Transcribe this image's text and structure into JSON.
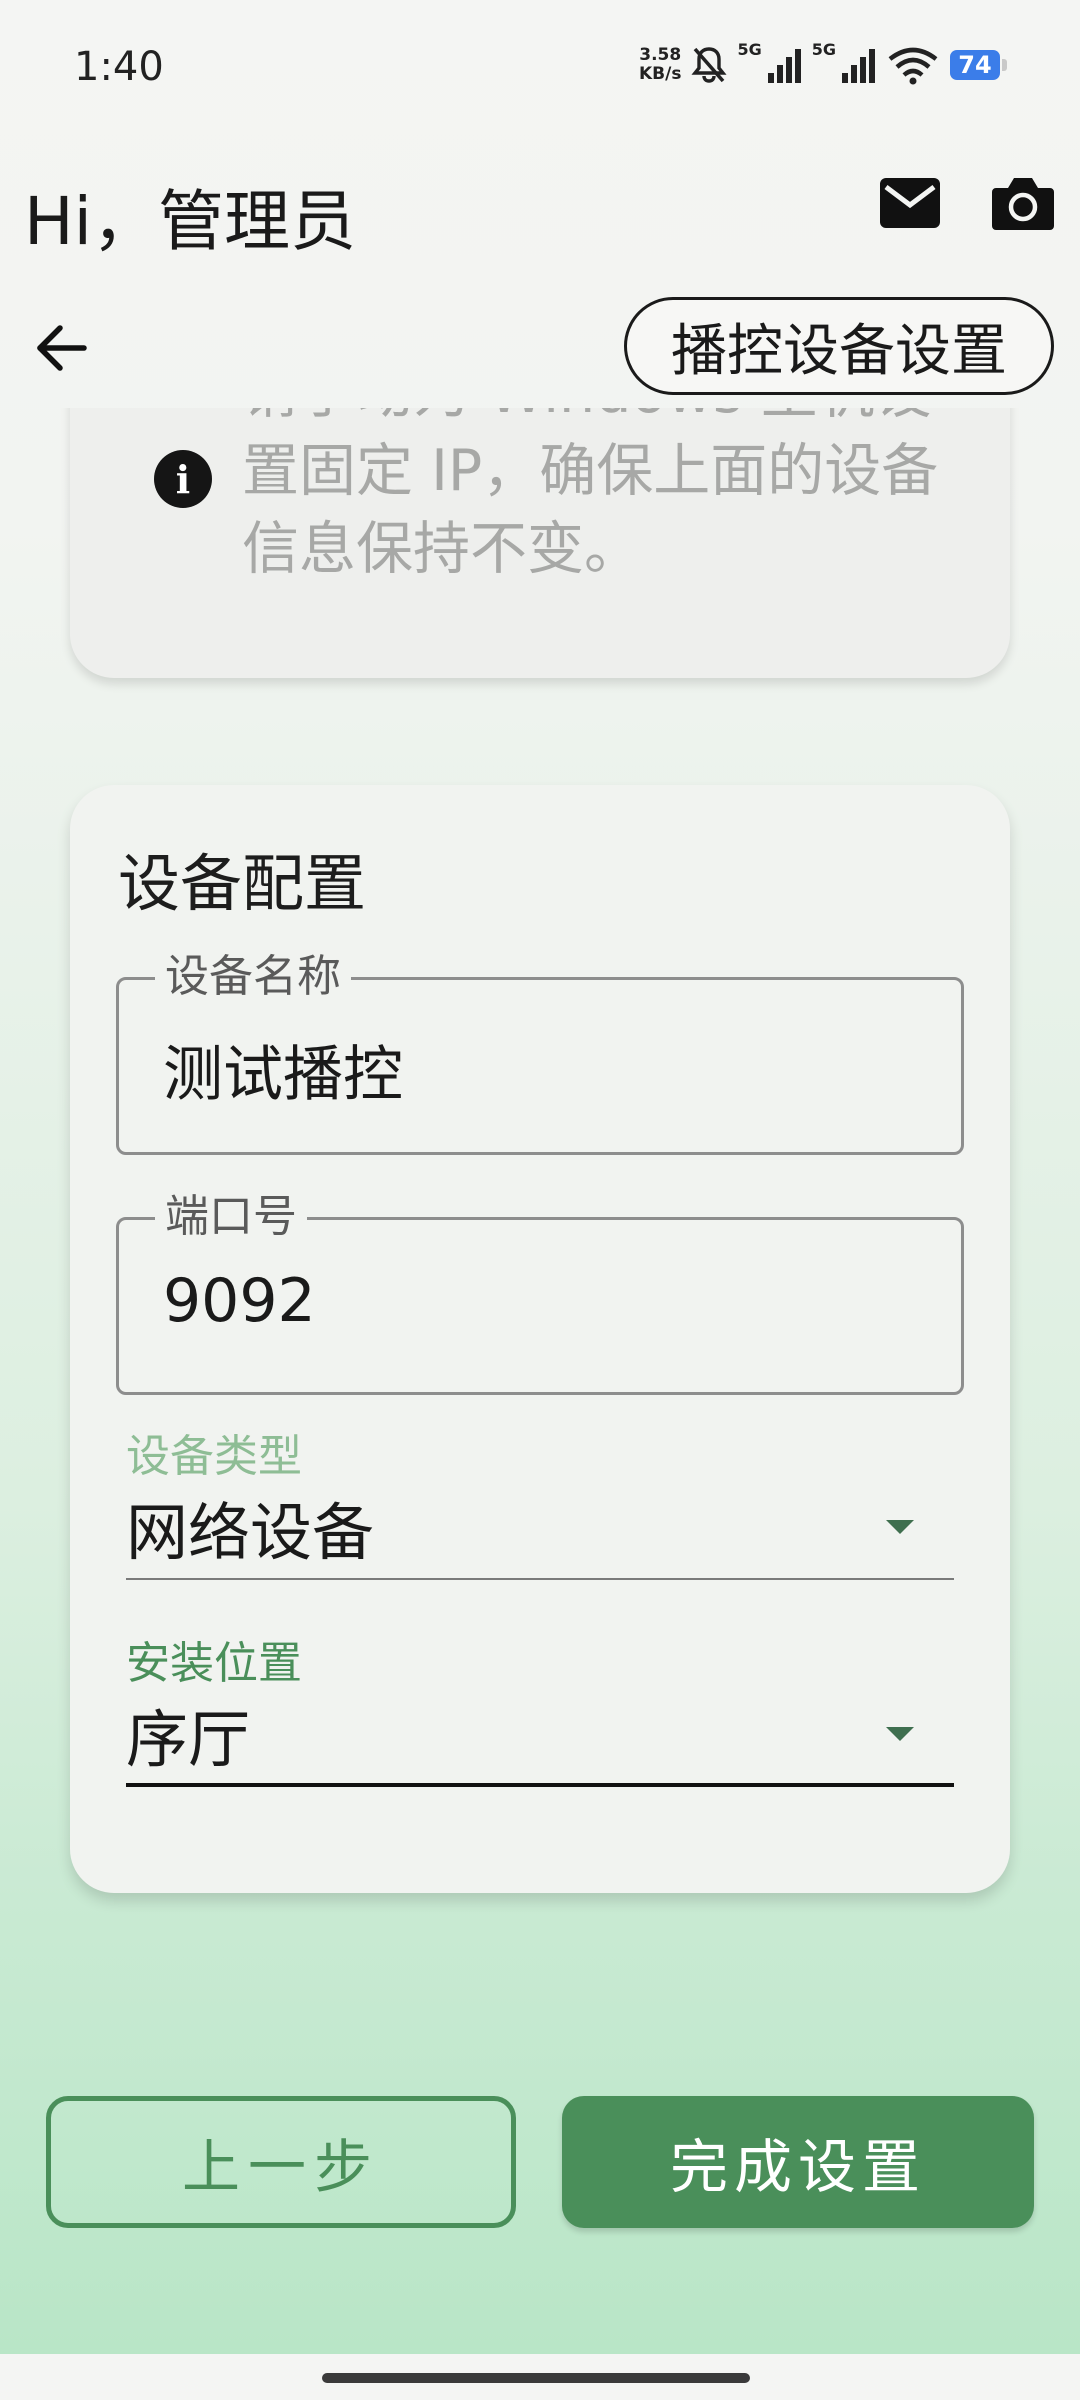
{
  "status_bar": {
    "time": "1:40",
    "net_speed_value": "3.58",
    "net_speed_unit": "KB/s",
    "sim1": "5G",
    "sim2": "5G",
    "battery": "74"
  },
  "header": {
    "greeting": "Hi，管理员",
    "mail_icon": "mail-icon",
    "camera_icon": "camera-icon"
  },
  "toolbar": {
    "back_icon": "back-arrow-icon",
    "title": "播控设备设置"
  },
  "info_card": {
    "icon": "info-icon",
    "text": "请手动为 Windows 主机设置固定 IP，确保上面的设备信息保持不变。"
  },
  "config": {
    "title": "设备配置",
    "device_name": {
      "label": "设备名称",
      "value": "测试播控"
    },
    "port": {
      "label": "端口号",
      "value": "9092"
    },
    "device_type": {
      "label": "设备类型",
      "value": "网络设备",
      "label_color": "#8ebd95"
    },
    "install_location": {
      "label": "安装位置",
      "value": "序厅",
      "label_color": "#4a8f5a"
    }
  },
  "actions": {
    "prev_label": "上一步",
    "finish_label": "完成设置",
    "accent_color": "#4a8f5a"
  }
}
